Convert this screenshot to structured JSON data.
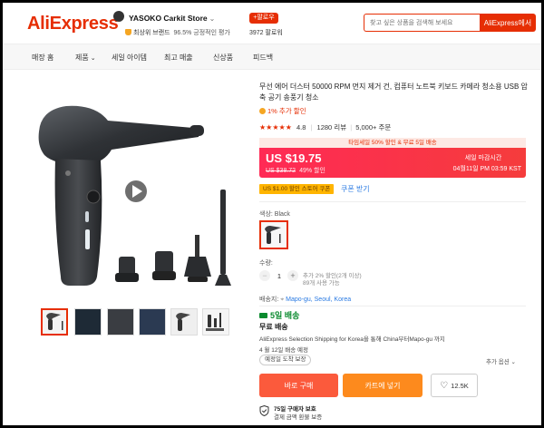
{
  "header": {
    "logo": "AliExpress",
    "store_name": "YASOKO Carkit Store",
    "store_chevron": "⌄",
    "store_badge": "최상위 브랜드",
    "store_rating": "96.5% 긍정적인 평가",
    "follow_label": "+팔로우",
    "follower_count": "3972 팔로워",
    "search_placeholder": "찾고 싶은 상품을 검색해 보세요",
    "search_button": "AliExpress에서"
  },
  "nav": {
    "items": [
      "매장 홈",
      "제품",
      "세일 아이템",
      "최고 매출",
      "신상품",
      "피드백"
    ]
  },
  "product": {
    "title": "무선 에어 더스터 50000 RPM 먼지 제거 건, 컴퓨터 노트북 키보드 카메라 청소용 USB 압축 공기 송풍기 청소",
    "rank": "1% 추가 할인",
    "rating": "4.8",
    "reviews": "1280 리뷰",
    "orders": "5,000+ 주문",
    "promo_banner": "타임세일 50% 할인 & 무료 5일 배송",
    "price": "US $19.75",
    "old_price": "US $38.72",
    "discount": "49% 할인",
    "sale_label": "세일 마감시간",
    "sale_time": "04월11일 PM 03:59 KST",
    "coupon_tag": "US $1.00 할인 스토어 쿠폰",
    "coupon_link": "쿠폰 받기",
    "color_label": "색상: Black",
    "qty_label": "수량:",
    "qty_minus": "−",
    "qty_value": "1",
    "qty_plus": "+",
    "qty_discount": "추가 2% 할인(2개 이상)",
    "qty_available": "89개 사용 가능",
    "ship_to_label": "배송지:",
    "ship_to_location": "Mapo-gu, Seoul, Korea",
    "fast_delivery": "5일 배송",
    "free_shipping": "무료 배송",
    "ship_desc": "AliExpress Selection Shipping for Korea을 통해 China부터Mapo-gu 까지",
    "ship_date": "4 월 12일 배송 예정",
    "arrival_chip": "예정일 도착 보장",
    "more_options": "추가 옵션 ⌄",
    "buy_now": "바로 구매",
    "add_cart": "카트에 넣기",
    "wishlist_count": "12.5K",
    "protect_title": "75일 구매자 보호",
    "protect_sub": "결제 금액 환불 보증"
  },
  "colors": {
    "brand": "#e62e04",
    "price_gradient_start": "#ff2a55",
    "buy_now": "#fb5a3c",
    "add_cart": "#fd8a1d",
    "delivery_green": "#0a8a2e"
  }
}
